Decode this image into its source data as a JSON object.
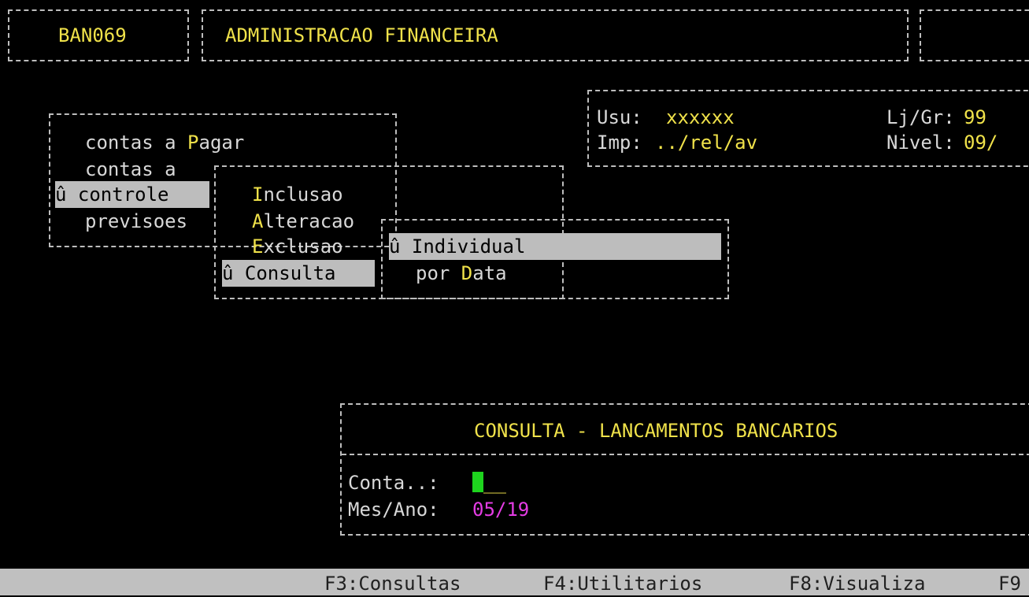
{
  "header": {
    "program_code": "BAN069",
    "system_title": "ADMINISTRACAO FINANCEIRA"
  },
  "info": {
    "user_label": "Usu:",
    "user_value": "xxxxxx",
    "printer_label": "Imp:",
    "printer_value": "../rel/av",
    "store_label": "Lj/Gr:",
    "store_value": "99",
    "level_label": "Nivel:",
    "level_value": "09/"
  },
  "main_menu": {
    "items": [
      {
        "prefix": "contas a ",
        "hotkey": "P",
        "rest": "agar"
      },
      {
        "prefix": "contas a",
        "hotkey": "",
        "rest": ""
      },
      {
        "marker": "û",
        "prefix": "controle",
        "hotkey": "",
        "rest": ""
      },
      {
        "prefix": "previsoes",
        "hotkey": "",
        "rest": ""
      }
    ]
  },
  "sub_menu": {
    "items": [
      {
        "hotkey": "I",
        "rest": "nclusao"
      },
      {
        "hotkey": "A",
        "rest": "lteracao"
      },
      {
        "hotkey": "E",
        "rest": "xclusao"
      },
      {
        "marker": "û",
        "hotkey": "C",
        "rest": "onsulta"
      }
    ]
  },
  "consulta_menu": {
    "items": [
      {
        "marker": "û",
        "hotkey": "I",
        "rest": "ndividual"
      },
      {
        "prefix": "por ",
        "hotkey": "D",
        "rest": "ata"
      }
    ]
  },
  "dialog": {
    "title": "CONSULTA - LANCAMENTOS BANCARIOS",
    "conta_label": "Conta..:",
    "conta_value": "__",
    "mes_ano_label": "Mes/Ano:",
    "mes_ano_value": "05/19"
  },
  "status_bar": {
    "items": [
      "F3:Consultas",
      "F4:Utilitarios",
      "F8:Visualiza",
      "F9"
    ]
  },
  "colors": {
    "background": "#000000",
    "highlight": "#f0e24a",
    "value_magenta": "#e43ce4",
    "cursor": "#1ed41e",
    "selection": "#bdbdbd"
  }
}
